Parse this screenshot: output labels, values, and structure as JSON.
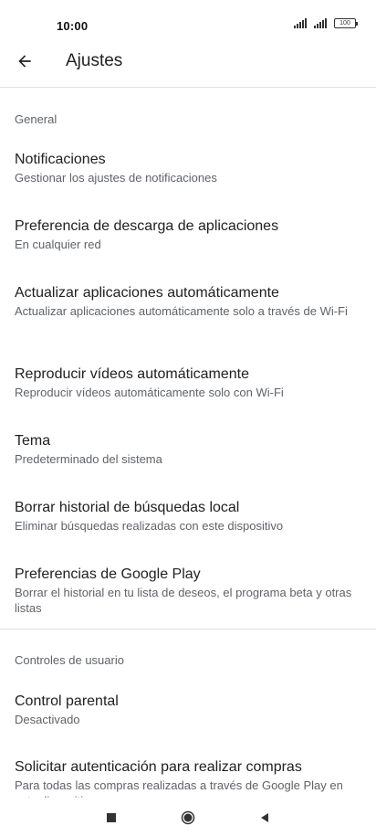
{
  "status_bar": {
    "time": "10:00",
    "battery": "100"
  },
  "app_bar": {
    "title": "Ajustes",
    "back_icon": "arrow-back-icon"
  },
  "sections": {
    "general": {
      "header": "General",
      "items": [
        {
          "title": "Notificaciones",
          "subtitle": "Gestionar los ajustes de notificaciones"
        },
        {
          "title": "Preferencia de descarga de aplicaciones",
          "subtitle": "En cualquier red"
        },
        {
          "title": "Actualizar aplicaciones automáticamente",
          "subtitle": "Actualizar aplicaciones automáticamente solo a través de Wi-Fi"
        },
        {
          "title": "Reproducir vídeos automáticamente",
          "subtitle": "Reproducir vídeos automáticamente solo con Wi-Fi"
        },
        {
          "title": "Tema",
          "subtitle": "Predeterminado del sistema"
        },
        {
          "title": "Borrar historial de búsquedas local",
          "subtitle": "Eliminar búsquedas realizadas con este dispositivo"
        },
        {
          "title": "Preferencias de Google Play",
          "subtitle": "Borrar el historial en tu lista de deseos, el programa beta y otras listas"
        }
      ]
    },
    "user_controls": {
      "header": "Controles de usuario",
      "items": [
        {
          "title": "Control parental",
          "subtitle": "Desactivado"
        },
        {
          "title": "Solicitar autenticación para realizar compras",
          "subtitle": "Para todas las compras realizadas a través de Google Play en este dispositivo"
        }
      ]
    }
  },
  "nav_bar": {
    "recents_icon": "square-icon",
    "home_icon": "circle-icon",
    "back_icon": "triangle-back-icon"
  }
}
